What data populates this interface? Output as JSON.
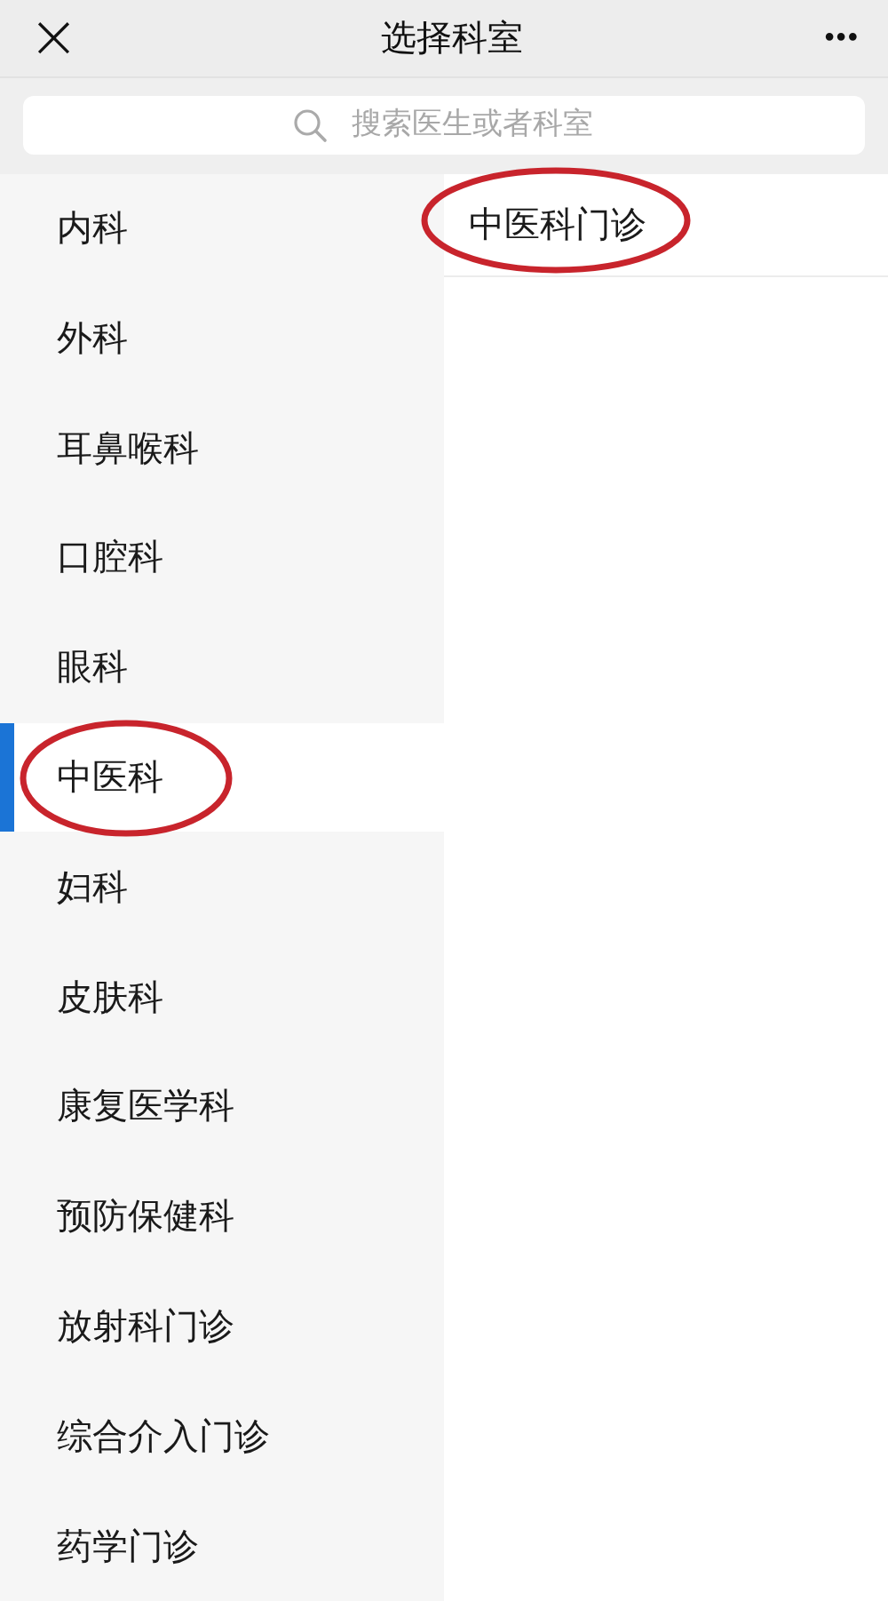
{
  "header": {
    "close": "×",
    "title": "选择科室",
    "more": "•••"
  },
  "search": {
    "placeholder": "搜索医生或者科室"
  },
  "departments": [
    {
      "label": "内科",
      "selected": false,
      "circled": false
    },
    {
      "label": "外科",
      "selected": false,
      "circled": false
    },
    {
      "label": "耳鼻喉科",
      "selected": false,
      "circled": false
    },
    {
      "label": "口腔科",
      "selected": false,
      "circled": false
    },
    {
      "label": "眼科",
      "selected": false,
      "circled": false
    },
    {
      "label": "中医科",
      "selected": true,
      "circled": true
    },
    {
      "label": "妇科",
      "selected": false,
      "circled": false
    },
    {
      "label": "皮肤科",
      "selected": false,
      "circled": false
    },
    {
      "label": "康复医学科",
      "selected": false,
      "circled": false
    },
    {
      "label": "预防保健科",
      "selected": false,
      "circled": false
    },
    {
      "label": "放射科门诊",
      "selected": false,
      "circled": false
    },
    {
      "label": "综合介入门诊",
      "selected": false,
      "circled": false
    },
    {
      "label": "药学门诊",
      "selected": false,
      "circled": false
    }
  ],
  "clinics": [
    {
      "label": "中医科门诊",
      "circled": true
    }
  ]
}
